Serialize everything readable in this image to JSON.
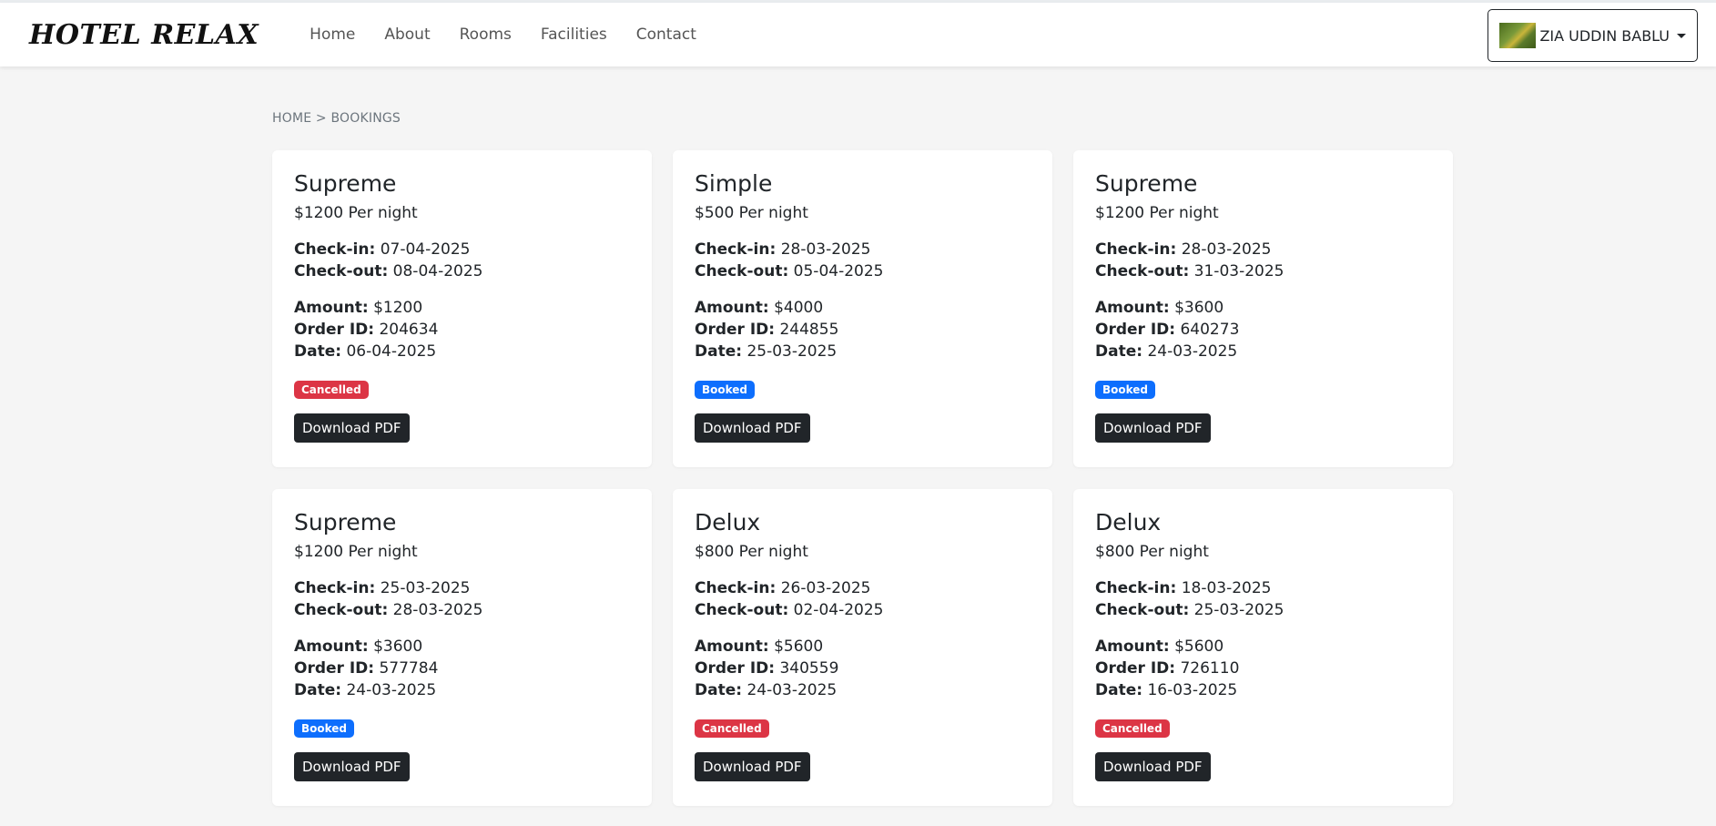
{
  "navbar": {
    "brand": "HOTEL RELAX",
    "links": [
      "Home",
      "About",
      "Rooms",
      "Facilities",
      "Contact"
    ],
    "user": "ZIA UDDIN BABLU"
  },
  "breadcrumb": "HOME > BOOKINGS",
  "labels": {
    "checkin": "Check-in:",
    "checkout": "Check-out:",
    "amount": "Amount:",
    "order": "Order ID:",
    "date": "Date:",
    "download": "Download PDF"
  },
  "bookings": [
    {
      "room": "Supreme",
      "price": "$1200 Per night",
      "checkin": "07-04-2025",
      "checkout": "08-04-2025",
      "amount": "$1200",
      "order_id": "204634",
      "date": "06-04-2025",
      "status": "Cancelled"
    },
    {
      "room": "Simple",
      "price": "$500 Per night",
      "checkin": "28-03-2025",
      "checkout": "05-04-2025",
      "amount": "$4000",
      "order_id": "244855",
      "date": "25-03-2025",
      "status": "Booked"
    },
    {
      "room": "Supreme",
      "price": "$1200 Per night",
      "checkin": "28-03-2025",
      "checkout": "31-03-2025",
      "amount": "$3600",
      "order_id": "640273",
      "date": "24-03-2025",
      "status": "Booked"
    },
    {
      "room": "Supreme",
      "price": "$1200 Per night",
      "checkin": "25-03-2025",
      "checkout": "28-03-2025",
      "amount": "$3600",
      "order_id": "577784",
      "date": "24-03-2025",
      "status": "Booked"
    },
    {
      "room": "Delux",
      "price": "$800 Per night",
      "checkin": "26-03-2025",
      "checkout": "02-04-2025",
      "amount": "$5600",
      "order_id": "340559",
      "date": "24-03-2025",
      "status": "Cancelled"
    },
    {
      "room": "Delux",
      "price": "$800 Per night",
      "checkin": "18-03-2025",
      "checkout": "25-03-2025",
      "amount": "$5600",
      "order_id": "726110",
      "date": "16-03-2025",
      "status": "Cancelled"
    }
  ],
  "colors": {
    "cancelled": "#dc3545",
    "booked": "#0d6efd",
    "button": "#212529"
  }
}
